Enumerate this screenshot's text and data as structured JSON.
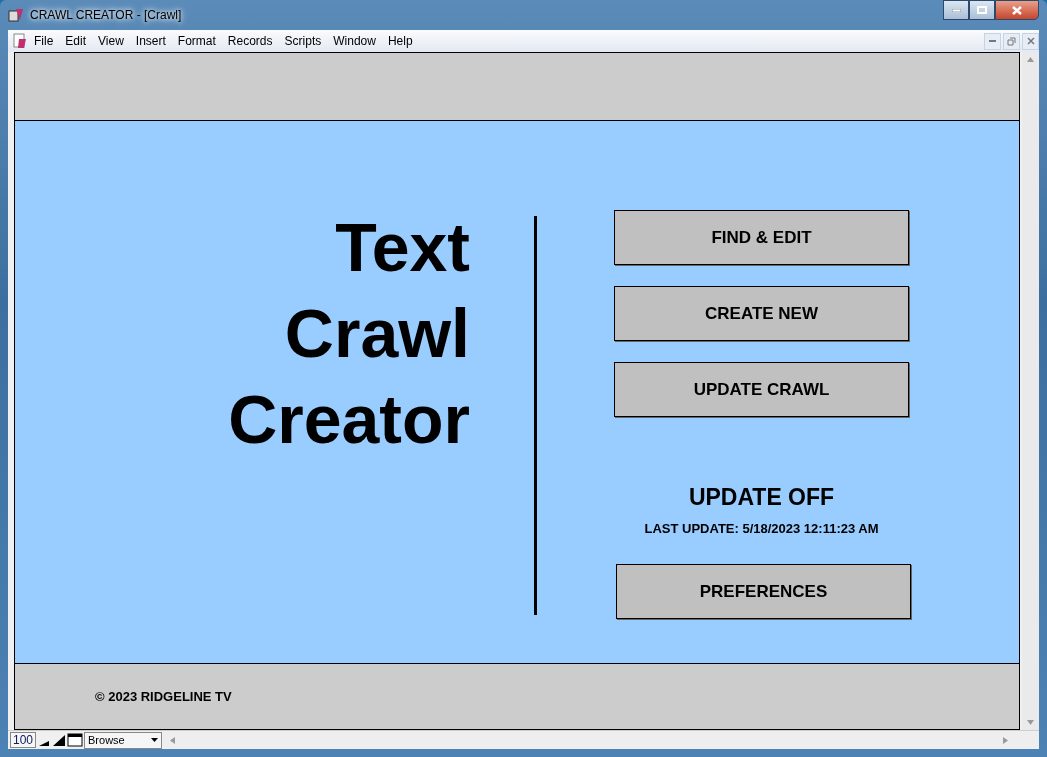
{
  "window": {
    "title": "CRAWL CREATOR - [Crawl]"
  },
  "menu": [
    "File",
    "Edit",
    "View",
    "Insert",
    "Format",
    "Records",
    "Scripts",
    "Window",
    "Help"
  ],
  "title_lines": [
    "Text",
    "Crawl",
    "Creator"
  ],
  "buttons": [
    "FIND & EDIT",
    "CREATE NEW",
    "UPDATE CRAWL"
  ],
  "update_status": "UPDATE OFF",
  "last_update": "LAST UPDATE: 5/18/2023 12:11:23 AM",
  "preferences_button": "PREFERENCES",
  "copyright": "©  2023 RIDGELINE TV",
  "status_bar": {
    "zoom": "100",
    "mode": "Browse"
  }
}
